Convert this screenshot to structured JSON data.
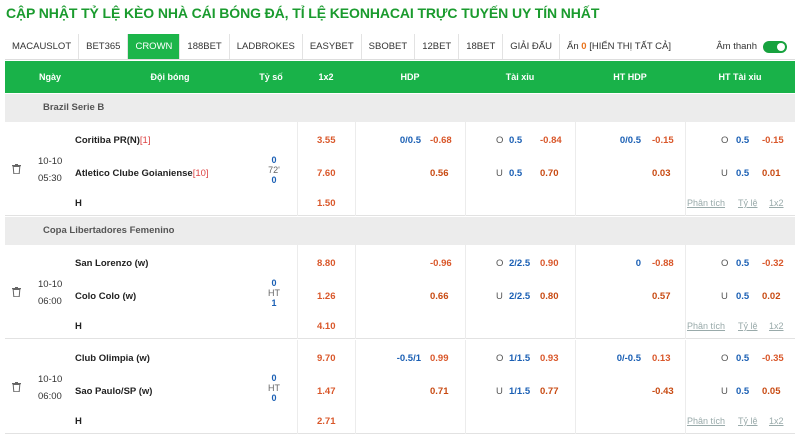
{
  "title": "CẬP NHẬT TỶ LỆ KÈO NHÀ CÁI BÓNG ĐÁ, TỈ LỆ KEONHACAI TRỰC TUYẾN UY TÍN NHẤT",
  "tabs": [
    "MACAUSLOT",
    "BET365",
    "CROWN",
    "188BET",
    "LADBROKES",
    "EASYBET",
    "SBOBET",
    "12BET",
    "18BET",
    "GIẢI ĐẤU"
  ],
  "active_tab": "CROWN",
  "hidden": {
    "label": "Ẩn",
    "count": "0",
    "show_all": "[HIỂN THỊ TẤT CẢ]"
  },
  "sound_label": "Âm thanh",
  "headers": {
    "date": "Ngày",
    "team": "Đội bóng",
    "score": "Tỷ số",
    "x12": "1x2",
    "hdp": "HDP",
    "ou": "Tài xỉu",
    "ht_hdp": "HT HDP",
    "ht_ou": "HT Tài xỉu"
  },
  "links": {
    "analysis": "Phân tích",
    "ratio": "Tỷ lệ",
    "x12": "1x2"
  },
  "leagues": [
    "Brazil Serie B",
    "Copa Libertadores Femenino"
  ],
  "matches": [
    {
      "date": "10-10",
      "time": "05:30",
      "home": "Coritiba PR(N)",
      "home_rank": "[1]",
      "away": "Atletico Clube Goianiense",
      "away_rank": "[10]",
      "score_home": "0",
      "score_mid": "72'",
      "score_away": "0",
      "o1": "3.55",
      "o2": "7.60",
      "ox": "1.50",
      "draw": "H",
      "hdp": {
        "line": "0/0.5",
        "top": "-0.68",
        "bot": "0.56"
      },
      "ou": {
        "top_side": "O",
        "top_line": "0.5",
        "top": "-0.84",
        "bot_side": "U",
        "bot_line": "0.5",
        "bot": "0.70"
      },
      "ht_hdp": {
        "line": "0/0.5",
        "top": "-0.15",
        "bot": "0.03"
      },
      "ht_ou": {
        "top_side": "O",
        "top_line": "0.5",
        "top": "-0.15",
        "bot_side": "U",
        "bot_line": "0.5",
        "bot": "0.01"
      }
    },
    {
      "date": "10-10",
      "time": "06:00",
      "home": "San Lorenzo (w)",
      "away": "Colo Colo (w)",
      "score_home": "0",
      "score_mid": "HT",
      "score_away": "1",
      "o1": "8.80",
      "o2": "1.26",
      "ox": "4.10",
      "draw": "H",
      "hdp": {
        "line": "",
        "top": "-0.96",
        "bot": "0.66"
      },
      "ou": {
        "top_side": "O",
        "top_line": "2/2.5",
        "top": "0.90",
        "bot_side": "U",
        "bot_line": "2/2.5",
        "bot": "0.80"
      },
      "ht_hdp": {
        "line": "0",
        "top": "-0.88",
        "bot": "0.57"
      },
      "ht_ou": {
        "top_side": "O",
        "top_line": "0.5",
        "top": "-0.32",
        "bot_side": "U",
        "bot_line": "0.5",
        "bot": "0.02"
      }
    },
    {
      "date": "10-10",
      "time": "06:00",
      "home": "Club Olimpia (w)",
      "away": "Sao Paulo/SP (w)",
      "score_home": "0",
      "score_mid": "HT",
      "score_away": "0",
      "o1": "9.70",
      "o2": "1.47",
      "ox": "2.71",
      "draw": "H",
      "hdp": {
        "line": "-0.5/1",
        "top": "0.99",
        "bot": "0.71"
      },
      "ou": {
        "top_side": "O",
        "top_line": "1/1.5",
        "top": "0.93",
        "bot_side": "U",
        "bot_line": "1/1.5",
        "bot": "0.77"
      },
      "ht_hdp": {
        "line": "0/-0.5",
        "top": "0.13",
        "bot": "-0.43"
      },
      "ht_ou": {
        "top_side": "O",
        "top_line": "0.5",
        "top": "-0.35",
        "bot_side": "U",
        "bot_line": "0.5",
        "bot": "0.05"
      }
    }
  ]
}
